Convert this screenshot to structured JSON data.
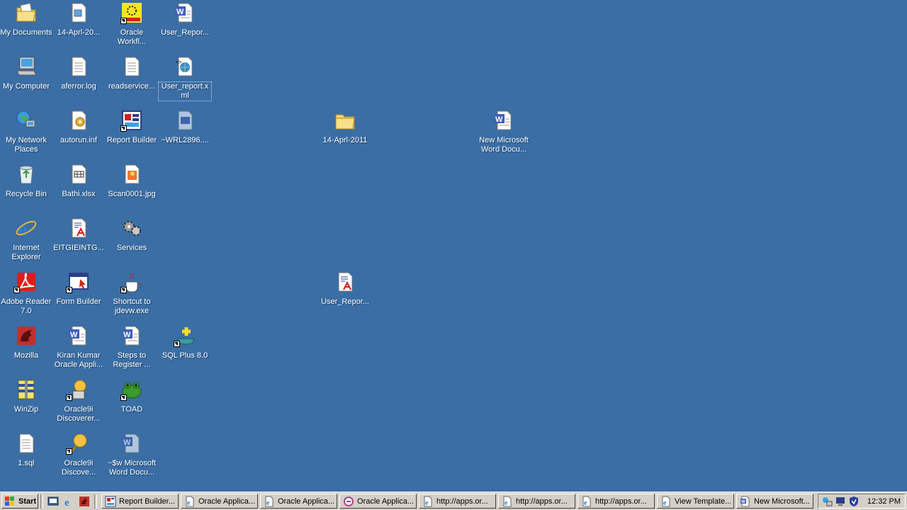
{
  "desktop": {
    "icons": [
      {
        "label": "My Documents",
        "icon": "folder-documents-icon"
      },
      {
        "label": "14-Aprl-20...",
        "icon": "file-icon"
      },
      {
        "label": "Oracle Workfl...",
        "icon": "oracle-workflow-icon"
      },
      {
        "label": "User_Repor...",
        "icon": "word-doc-icon"
      },
      {
        "label": "My Computer",
        "icon": "computer-icon"
      },
      {
        "label": "aferror.log",
        "icon": "text-file-icon"
      },
      {
        "label": "readservice...",
        "icon": "text-file-icon"
      },
      {
        "label": "User_report.xml",
        "icon": "xml-file-icon"
      },
      {
        "label": "My Network Places",
        "icon": "network-icon"
      },
      {
        "label": "autorun.inf",
        "icon": "settings-file-icon"
      },
      {
        "label": "Report Builder",
        "icon": "report-builder-icon"
      },
      {
        "label": "~WRL2896....",
        "icon": "temp-file-icon"
      },
      {
        "label": "Recycle Bin",
        "icon": "recycle-bin-icon"
      },
      {
        "label": "Bathi.xlsx",
        "icon": "excel-file-icon"
      },
      {
        "label": "Scan0001.jpg",
        "icon": "image-file-icon"
      },
      {
        "label": "Internet Explorer",
        "icon": "internet-explorer-icon"
      },
      {
        "label": "EITGIEINTG...",
        "icon": "report-file-icon"
      },
      {
        "label": "Services",
        "icon": "services-icon"
      },
      {
        "label": "Adobe Reader 7.0",
        "icon": "adobe-reader-icon"
      },
      {
        "label": "Form Builder",
        "icon": "form-builder-icon"
      },
      {
        "label": "Shortcut to jdevw.exe",
        "icon": "java-icon"
      },
      {
        "label": "Mozilla",
        "icon": "mozilla-icon"
      },
      {
        "label": "Kiran Kumar Oracle Appli...",
        "icon": "word-doc-icon"
      },
      {
        "label": "Steps to Register ...",
        "icon": "word-doc-icon"
      },
      {
        "label": "SQL Plus 8.0",
        "icon": "sqlplus-icon"
      },
      {
        "label": "WinZip",
        "icon": "winzip-icon"
      },
      {
        "label": "Oracle9i Discoverer...",
        "icon": "discoverer-icon"
      },
      {
        "label": "TOAD",
        "icon": "toad-icon"
      },
      {
        "label": "1.sql",
        "icon": "text-file-icon"
      },
      {
        "label": "Oracle9i Discove...",
        "icon": "discoverer-icon"
      },
      {
        "label": "~$w Microsoft Word Docu...",
        "icon": "word-temp-icon"
      },
      {
        "label": "14-Aprl-2011",
        "icon": "folder-icon"
      },
      {
        "label": "New Microsoft Word Docu...",
        "icon": "word-doc-icon"
      },
      {
        "label": "User_Repor...",
        "icon": "report-file-icon"
      }
    ]
  },
  "taskbar": {
    "start_label": "Start",
    "tasks": [
      {
        "label": "Report Builder...",
        "icon": "report-builder-icon"
      },
      {
        "label": "Oracle Applica...",
        "icon": "ie-page-icon"
      },
      {
        "label": "Oracle Applica...",
        "icon": "ie-page-icon"
      },
      {
        "label": "Oracle Applica...",
        "icon": "oracle-app-icon"
      },
      {
        "label": "http://apps.or...",
        "icon": "ie-page-icon"
      },
      {
        "label": "http://apps.or...",
        "icon": "ie-page-icon"
      },
      {
        "label": "http://apps.or...",
        "icon": "ie-page-icon"
      },
      {
        "label": "View Template...",
        "icon": "ie-page-icon"
      },
      {
        "label": "New Microsoft...",
        "icon": "word-doc-icon"
      }
    ],
    "clock": "12:32 PM"
  },
  "colors": {
    "desktop": "#3a6ea5",
    "taskbar": "#d4d0c8"
  }
}
